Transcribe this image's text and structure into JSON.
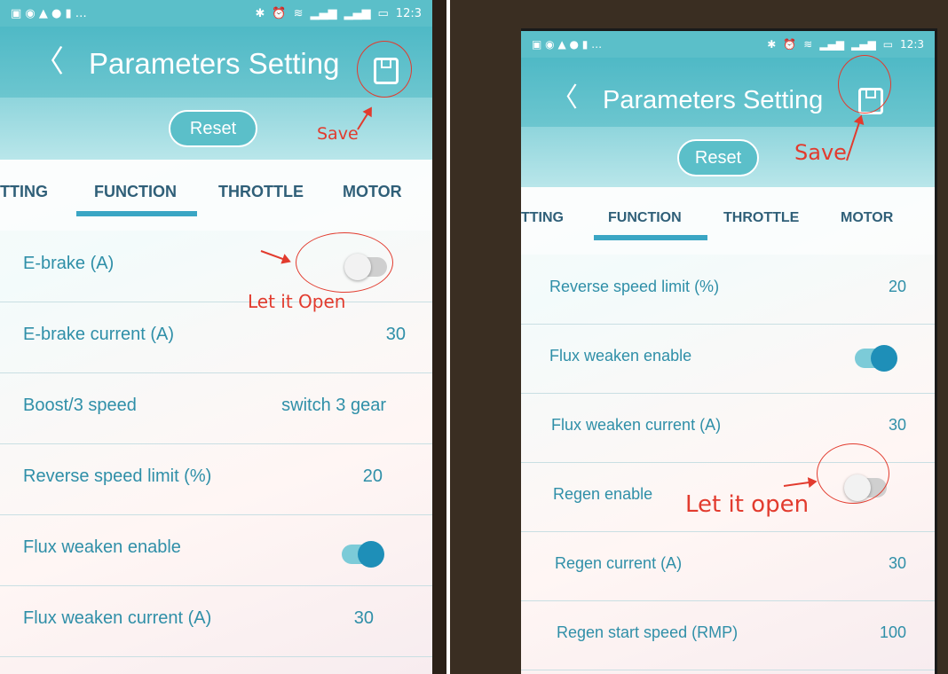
{
  "app": {
    "title": "Parameters Setting",
    "status_time": "12:3",
    "status_icons": [
      "bluetooth-icon",
      "alarm-icon",
      "wifi-icon",
      "signal-icon",
      "battery-icon"
    ],
    "reset_label": "Reset",
    "colors": {
      "accent": "#5bbfc9",
      "text": "#2f8fa8",
      "toggle_on": "#1e8fb8",
      "annotation": "#e23b2e"
    }
  },
  "left": {
    "tabs": [
      "TTING",
      "FUNCTION",
      "THROTTLE",
      "MOTOR"
    ],
    "active_tab": "FUNCTION",
    "rows": [
      {
        "label": "E-brake (A)",
        "toggle": "off"
      },
      {
        "label": "E-brake current (A)",
        "value": "30"
      },
      {
        "label": "Boost/3 speed",
        "value": "switch 3 gear"
      },
      {
        "label": "Reverse speed limit (%)",
        "value": "20"
      },
      {
        "label": "Flux weaken enable",
        "toggle": "on"
      },
      {
        "label": "Flux weaken current (A)",
        "value": "30"
      }
    ],
    "annotations": {
      "save": "Save",
      "toggle_note": "Let it Open"
    }
  },
  "right": {
    "tabs": [
      "TTING",
      "FUNCTION",
      "THROTTLE",
      "MOTOR"
    ],
    "active_tab": "FUNCTION",
    "rows": [
      {
        "label": "Reverse speed limit (%)",
        "value": "20"
      },
      {
        "label": "Flux weaken enable",
        "toggle": "on"
      },
      {
        "label": "Flux weaken current (A)",
        "value": "30"
      },
      {
        "label": "Regen enable",
        "toggle": "off"
      },
      {
        "label": "Regen current (A)",
        "value": "30"
      },
      {
        "label": "Regen start speed (RMP)",
        "value": "100"
      }
    ],
    "annotations": {
      "save": "Save",
      "toggle_note": "Let it open"
    }
  }
}
